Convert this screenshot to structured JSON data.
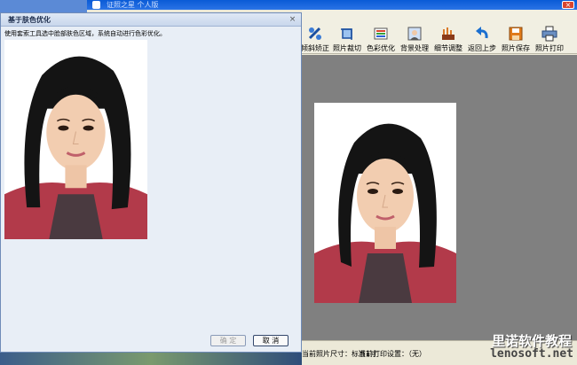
{
  "app": {
    "title": "证照之星 个人版"
  },
  "toolbar": {
    "items": [
      {
        "label": "倾斜矫正",
        "icon": "tilt-correct-icon"
      },
      {
        "label": "照片裁切",
        "icon": "crop-icon"
      },
      {
        "label": "色彩优化",
        "icon": "color-optimize-icon"
      },
      {
        "label": "背景处理",
        "icon": "background-icon"
      },
      {
        "label": "细节调整",
        "icon": "detail-adjust-icon"
      },
      {
        "label": "返回上步",
        "icon": "undo-icon"
      },
      {
        "label": "照片保存",
        "icon": "save-icon"
      },
      {
        "label": "照片打印",
        "icon": "print-icon"
      }
    ]
  },
  "status": {
    "size": "当前照片尺寸：标准1寸",
    "print": "当前打印设置：（无）"
  },
  "watermark": {
    "cn": "里诺软件教程",
    "en": "lenosoft.net"
  },
  "dialog": {
    "title": "基于肤色优化",
    "instruction": "使用套索工具选中脸部肤色区域，系统自动进行色彩优化。",
    "ok_label": "确  定",
    "cancel_label": "取  消",
    "close_glyph": "×"
  }
}
